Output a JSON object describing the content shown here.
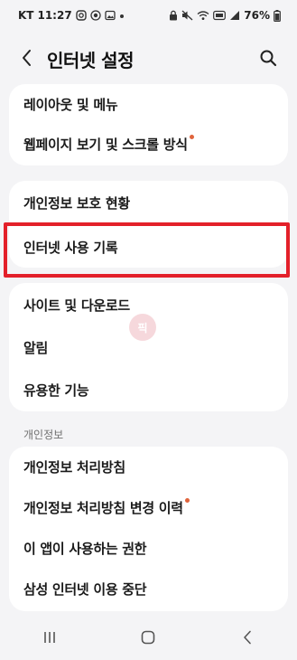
{
  "status_bar": {
    "carrier": "KT",
    "time": "11:27",
    "battery": "76%"
  },
  "header": {
    "title": "인터넷 설정"
  },
  "groups": [
    {
      "items": [
        {
          "label": "레이아웃 및 메뉴",
          "badge": false
        },
        {
          "label": "웹페이지 보기 및 스크롤 방식",
          "badge": true
        }
      ]
    },
    {
      "items": [
        {
          "label": "개인정보 보호 현황",
          "badge": false
        },
        {
          "label": "인터넷 사용 기록",
          "badge": false,
          "highlighted": true
        }
      ]
    },
    {
      "items": [
        {
          "label": "사이트 및 다운로드",
          "badge": false
        },
        {
          "label": "알림",
          "badge": false
        },
        {
          "label": "유용한 기능",
          "badge": false
        }
      ]
    },
    {
      "section_title": "개인정보",
      "items": [
        {
          "label": "개인정보 처리방침",
          "badge": false
        },
        {
          "label": "개인정보 처리방침 변경 이력",
          "badge": true
        },
        {
          "label": "이 앱이 사용하는 권한",
          "badge": false
        },
        {
          "label": "삼성 인터넷 이용 중단",
          "badge": false
        }
      ]
    }
  ],
  "watermark": "픽",
  "colors": {
    "background": "#f4f4f6",
    "card": "#ffffff",
    "badge": "#e0643c",
    "highlight_border": "#e3202a"
  },
  "icons": {
    "back": "chevron-left-icon",
    "search": "search-icon",
    "nav_recent": "recent-apps-icon",
    "nav_home": "home-icon",
    "nav_back": "back-icon"
  }
}
